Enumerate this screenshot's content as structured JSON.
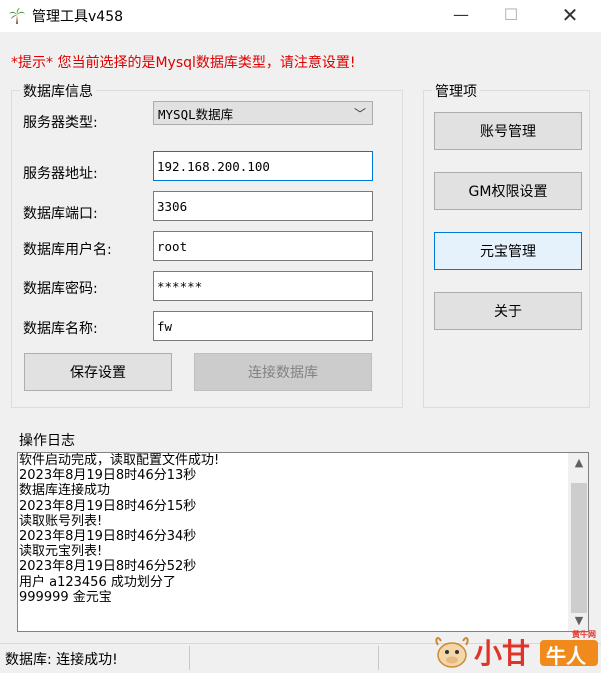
{
  "window": {
    "title": "管理工具v458",
    "minimize_icon": "minimize-icon",
    "maximize_icon": "maximize-icon",
    "close_icon": "close-icon",
    "minimize_glyph": "—",
    "maximize_glyph": "☐",
    "close_glyph": "✕"
  },
  "warning": "*提示* 您当前选择的是Mysql数据库类型，请注意设置!",
  "db_group": {
    "title": "数据库信息",
    "server_type_label": "服务器类型:",
    "server_type_value": "MYSQL数据库",
    "server_address_label": "服务器地址:",
    "server_address_value": "192.168.200.100",
    "port_label": "数据库端口:",
    "port_value": "3306",
    "username_label": "数据库用户名:",
    "username_value": "root",
    "password_label": "数据库密码:",
    "password_value": "******",
    "dbname_label": "数据库名称:",
    "dbname_value": "fw",
    "save_button": "保存设置",
    "connect_button": "连接数据库"
  },
  "manage_group": {
    "title": "管理项",
    "account_button": "账号管理",
    "gm_button": "GM权限设置",
    "yuanbao_button": "元宝管理",
    "about_button": "关于"
  },
  "log": {
    "title": "操作日志",
    "lines": [
      "软件启动完成，读取配置文件成功!",
      "2023年8月19日8时46分13秒",
      "数据库连接成功",
      "2023年8月19日8时46分15秒",
      "读取账号列表!",
      "2023年8月19日8时46分34秒",
      "读取元宝列表!",
      "2023年8月19日8时46分52秒",
      "用户 a123456 成功划分了",
      "999999 金元宝"
    ],
    "scroll_up_glyph": "▲",
    "scroll_down_glyph": "▼"
  },
  "status": {
    "text": "数据库: 连接成功!"
  },
  "watermark": {
    "text_main": "小甘",
    "text_badge": "牛人",
    "text_small": "黄牛网"
  },
  "colors": {
    "warning": "#e00000",
    "focus_border": "#0078d7",
    "button_bg": "#e1e1e1",
    "window_bg": "#f0f0f0"
  }
}
